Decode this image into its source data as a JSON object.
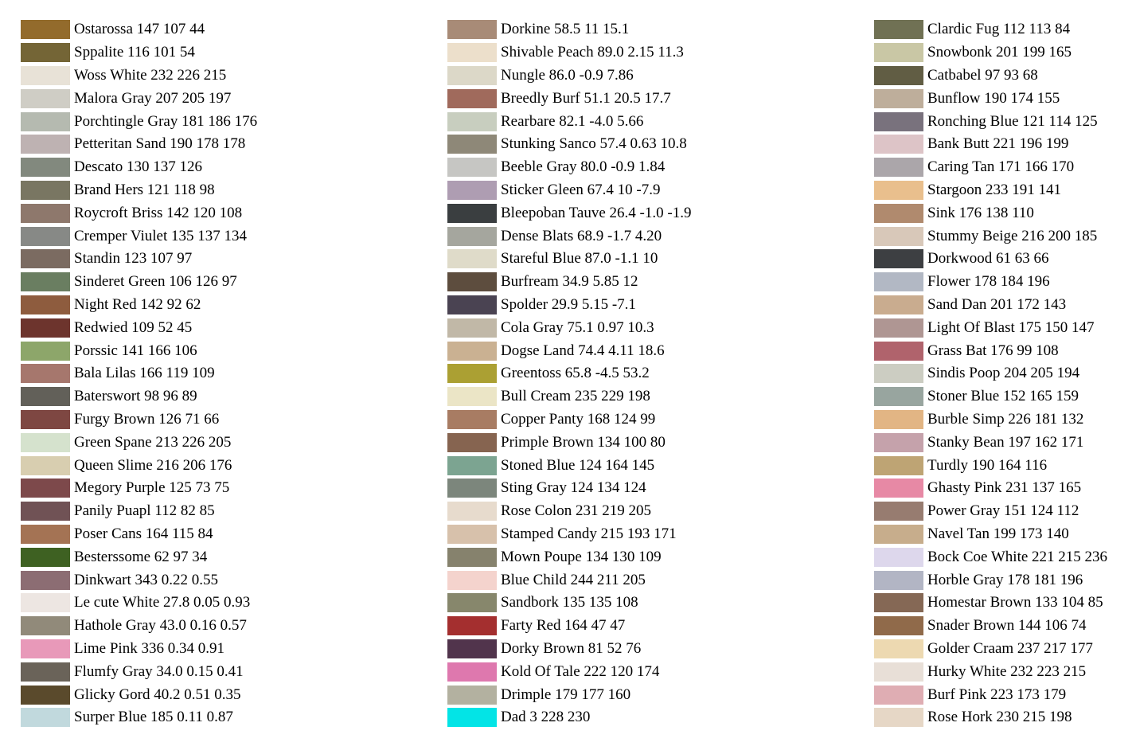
{
  "columns": [
    {
      "items": [
        {
          "label": "Ostarossa 147 107 44",
          "color": "#936b2c"
        },
        {
          "label": "Sppalite 116 101 54",
          "color": "#746536"
        },
        {
          "label": "Woss White 232 226 215",
          "color": "#e8e2d7"
        },
        {
          "label": "Malora Gray 207 205 197",
          "color": "#cfcdc5"
        },
        {
          "label": "Porchtingle Gray 181 186 176",
          "color": "#b5bab0"
        },
        {
          "label": "Petteritan Sand 190 178 178",
          "color": "#beb2b2"
        },
        {
          "label": "Descato 130 137 126",
          "color": "#82897e"
        },
        {
          "label": "Brand Hers 121 118 98",
          "color": "#797662"
        },
        {
          "label": "Roycroft Briss 142 120 108",
          "color": "#8e786c"
        },
        {
          "label": "Cremper Viulet 135 137 134",
          "color": "#878986"
        },
        {
          "label": "Standin 123 107 97",
          "color": "#7b6b61"
        },
        {
          "label": "Sinderet Green 106 126 97",
          "color": "#6a7e61"
        },
        {
          "label": "Night Red 142 92 62",
          "color": "#8e5c3e"
        },
        {
          "label": "Redwied 109 52 45",
          "color": "#6d342d"
        },
        {
          "label": "Porssic 141 166 106",
          "color": "#8da66a"
        },
        {
          "label": "Bala Lilas 166 119 109",
          "color": "#a6776d"
        },
        {
          "label": "Baterswort 98 96 89",
          "color": "#626059"
        },
        {
          "label": "Furgy Brown 126 71 66",
          "color": "#7e4742"
        },
        {
          "label": "Green Spane 213 226 205",
          "color": "#d5e2cd"
        },
        {
          "label": "Queen Slime 216 206 176",
          "color": "#d8ceb0"
        },
        {
          "label": "Megory Purple 125 73 75",
          "color": "#7d494b"
        },
        {
          "label": "Panily Puapl 112 82 85",
          "color": "#705255"
        },
        {
          "label": "Poser Cans 164 115 84",
          "color": "#a47354"
        },
        {
          "label": "Besterssome 62 97 34",
          "color": "#3e6122"
        },
        {
          "label": "Dinkwart 343 0.22 0.55",
          "color": "#8c6d73"
        },
        {
          "label": "Le cute White 27.8 0.05 0.93",
          "color": "#ede6e2"
        },
        {
          "label": "Hathole Gray 43.0 0.16 0.57",
          "color": "#918a7a"
        },
        {
          "label": "Lime Pink 336 0.34 0.91",
          "color": "#e899b9"
        },
        {
          "label": "Flumfy Gray 34.0 0.15 0.41",
          "color": "#6a6359"
        },
        {
          "label": "Glicky Gord 40.2 0.51 0.35",
          "color": "#5a4a2c"
        },
        {
          "label": "Surper Blue 185 0.11 0.87",
          "color": "#c1d9dd"
        }
      ]
    },
    {
      "items": [
        {
          "label": "Dorkine 58.5 11 15.1",
          "color": "#a88b77"
        },
        {
          "label": "Shivable Peach 89.0 2.15 11.3",
          "color": "#ecdfcb"
        },
        {
          "label": "Nungle 86.0 -0.9 7.86",
          "color": "#dcd8c8"
        },
        {
          "label": "Breedly Burf 51.1 20.5 17.7",
          "color": "#a06a5c"
        },
        {
          "label": "Rearbare 82.1 -4.0 5.66",
          "color": "#c8cebf"
        },
        {
          "label": "Stunking Sanco 57.4 0.63 10.8",
          "color": "#8e8878"
        },
        {
          "label": "Beeble Gray 80.0 -0.9 1.84",
          "color": "#c6c6c3"
        },
        {
          "label": "Sticker Gleen 67.4 10 -7.9",
          "color": "#ae9db2"
        },
        {
          "label": "Bleepoban Tauve 26.4 -1.0 -1.9",
          "color": "#3a3e40"
        },
        {
          "label": "Dense Blats 68.9 -1.7 4.20",
          "color": "#a5a69e"
        },
        {
          "label": "Stareful Blue 87.0 -1.1 10",
          "color": "#dfdbc9"
        },
        {
          "label": "Burfream 34.9 5.85 12",
          "color": "#5d4d3e"
        },
        {
          "label": "Spolder 29.9 5.15 -7.1",
          "color": "#4a4352"
        },
        {
          "label": "Cola Gray 75.1 0.97 10.3",
          "color": "#c1b8a7"
        },
        {
          "label": "Dogse Land 74.4 4.11 18.6",
          "color": "#cab192"
        },
        {
          "label": "Greentoss 65.8 -4.5 53.2",
          "color": "#aba033"
        },
        {
          "label": "Bull Cream 235 229 198",
          "color": "#ebe5c6"
        },
        {
          "label": "Copper Panty 168 124 99",
          "color": "#a87c63"
        },
        {
          "label": "Primple Brown 134 100 80",
          "color": "#866450"
        },
        {
          "label": "Stoned Blue 124 164 145",
          "color": "#7ca491"
        },
        {
          "label": "Sting Gray 124 134 124",
          "color": "#7c867c"
        },
        {
          "label": "Rose Colon 231 219 205",
          "color": "#e7dbcd"
        },
        {
          "label": "Stamped Candy 215 193 171",
          "color": "#d7c1ab"
        },
        {
          "label": "Mown Poupe 134 130 109",
          "color": "#86826d"
        },
        {
          "label": "Blue Child 244 211 205",
          "color": "#f4d3cd"
        },
        {
          "label": "Sandbork 135 135 108",
          "color": "#87876c"
        },
        {
          "label": "Farty Red 164 47 47",
          "color": "#a42f2f"
        },
        {
          "label": "Dorky Brown 81 52 76",
          "color": "#51344c"
        },
        {
          "label": "Kold Of Tale 222 120 174",
          "color": "#de78ae"
        },
        {
          "label": "Drimple 179 177 160",
          "color": "#b3b1a0"
        },
        {
          "label": "Dad 3 228 230",
          "color": "#03e4e6"
        }
      ]
    },
    {
      "items": [
        {
          "label": "Clardic Fug 112 113 84",
          "color": "#707154"
        },
        {
          "label": "Snowbonk 201 199 165",
          "color": "#c9c7a5"
        },
        {
          "label": "Catbabel 97 93 68",
          "color": "#615d44"
        },
        {
          "label": "Bunflow 190 174 155",
          "color": "#beae9b"
        },
        {
          "label": "Ronching Blue 121 114 125",
          "color": "#79727d"
        },
        {
          "label": "Bank Butt 221 196 199",
          "color": "#ddc4c7"
        },
        {
          "label": "Caring Tan 171 166 170",
          "color": "#aba6aa"
        },
        {
          "label": "Stargoon 233 191 141",
          "color": "#e9bf8d"
        },
        {
          "label": "Sink 176 138 110",
          "color": "#b08a6e"
        },
        {
          "label": "Stummy Beige 216 200 185",
          "color": "#d8c8b9"
        },
        {
          "label": "Dorkwood 61 63 66",
          "color": "#3d3f42"
        },
        {
          "label": "Flower 178 184 196",
          "color": "#b2b8c4"
        },
        {
          "label": "Sand Dan 201 172 143",
          "color": "#c9ac8f"
        },
        {
          "label": "Light Of Blast 175 150 147",
          "color": "#af9693"
        },
        {
          "label": "Grass Bat 176 99 108",
          "color": "#b0636c"
        },
        {
          "label": "Sindis Poop 204 205 194",
          "color": "#cccdc2"
        },
        {
          "label": "Stoner Blue 152 165 159",
          "color": "#98a59f"
        },
        {
          "label": "Burble Simp 226 181 132",
          "color": "#e2b584"
        },
        {
          "label": "Stanky Bean 197 162 171",
          "color": "#c5a2ab"
        },
        {
          "label": "Turdly 190 164 116",
          "color": "#bea474"
        },
        {
          "label": "Ghasty Pink 231 137 165",
          "color": "#e789a5"
        },
        {
          "label": "Power Gray 151 124 112",
          "color": "#977c70"
        },
        {
          "label": "Navel Tan 199 173 140",
          "color": "#c7ad8c"
        },
        {
          "label": "Bock Coe White 221 215 236",
          "color": "#ddd7ec"
        },
        {
          "label": "Horble Gray 178 181 196",
          "color": "#b2b5c4"
        },
        {
          "label": "Homestar Brown 133 104 85",
          "color": "#856855"
        },
        {
          "label": "Snader Brown 144 106 74",
          "color": "#906a4a"
        },
        {
          "label": "Golder Craam 237 217 177",
          "color": "#edd9b1"
        },
        {
          "label": "Hurky White 232 223 215",
          "color": "#e8dfd7"
        },
        {
          "label": "Burf Pink 223 173 179",
          "color": "#dfadb3"
        },
        {
          "label": "Rose Hork 230 215 198",
          "color": "#e6d7c6"
        }
      ]
    }
  ]
}
